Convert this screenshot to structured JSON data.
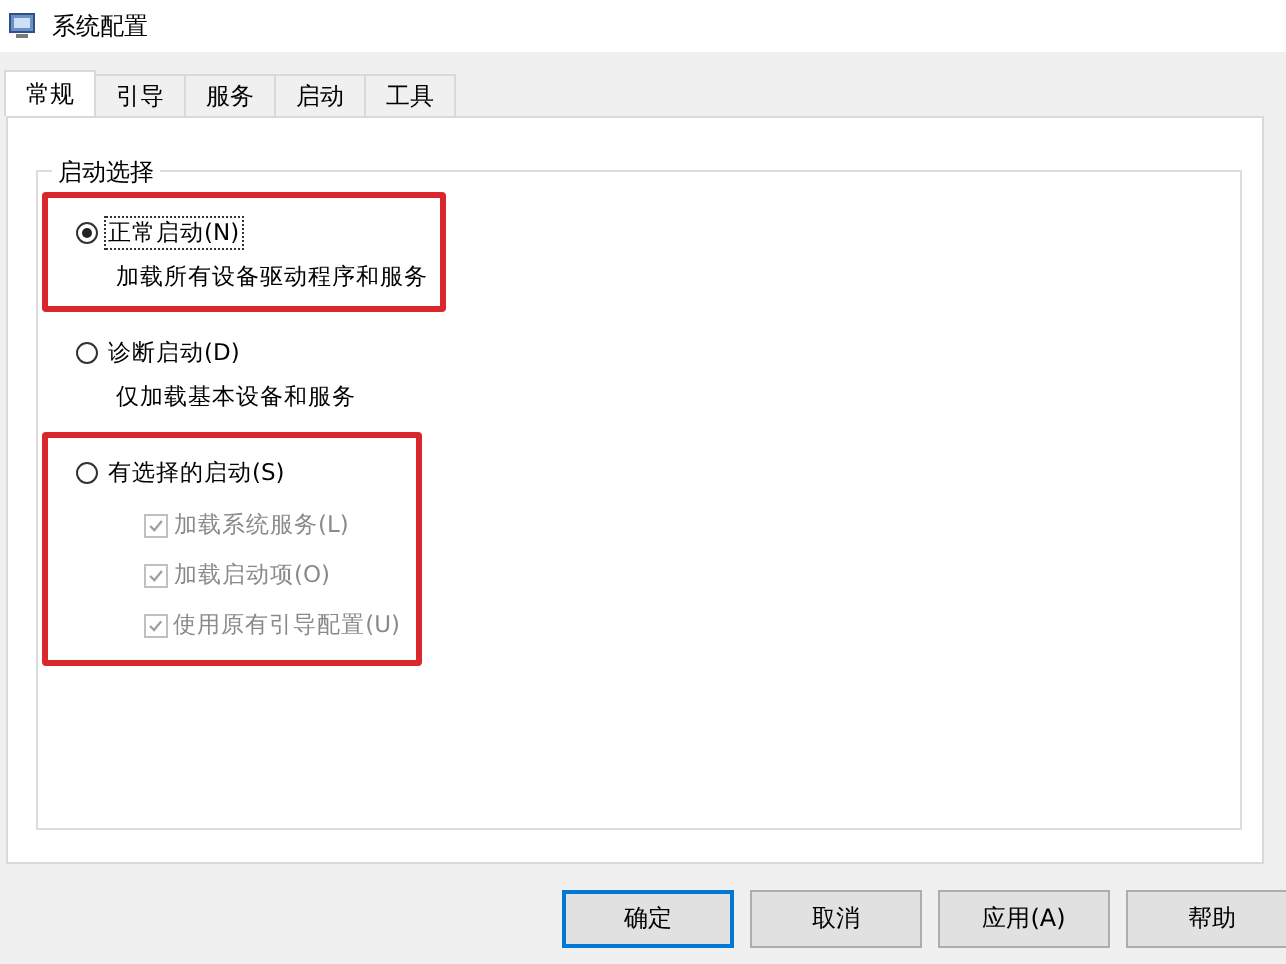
{
  "window": {
    "title": "系统配置"
  },
  "tabs": [
    {
      "label": "常规",
      "selected": true
    },
    {
      "label": "引导",
      "selected": false
    },
    {
      "label": "服务",
      "selected": false
    },
    {
      "label": "启动",
      "selected": false
    },
    {
      "label": "工具",
      "selected": false
    }
  ],
  "group": {
    "title": "启动选择",
    "options": [
      {
        "label": "正常启动(N)",
        "selected": true,
        "focused": true,
        "highlighted": true,
        "description": "加载所有设备驱动程序和服务"
      },
      {
        "label": "诊断启动(D)",
        "selected": false,
        "focused": false,
        "highlighted": false,
        "description": "仅加载基本设备和服务"
      },
      {
        "label": "有选择的启动(S)",
        "selected": false,
        "focused": false,
        "highlighted": true,
        "checkboxes": [
          {
            "label": "加载系统服务(L)",
            "checked": true,
            "disabled": true
          },
          {
            "label": "加载启动项(O)",
            "checked": true,
            "disabled": true
          },
          {
            "label": "使用原有引导配置(U)",
            "checked": true,
            "disabled": true
          }
        ]
      }
    ]
  },
  "buttons": [
    {
      "label": "确定",
      "default": true
    },
    {
      "label": "取消",
      "default": false
    },
    {
      "label": "应用(A)",
      "default": false
    },
    {
      "label": "帮助",
      "default": false
    }
  ]
}
